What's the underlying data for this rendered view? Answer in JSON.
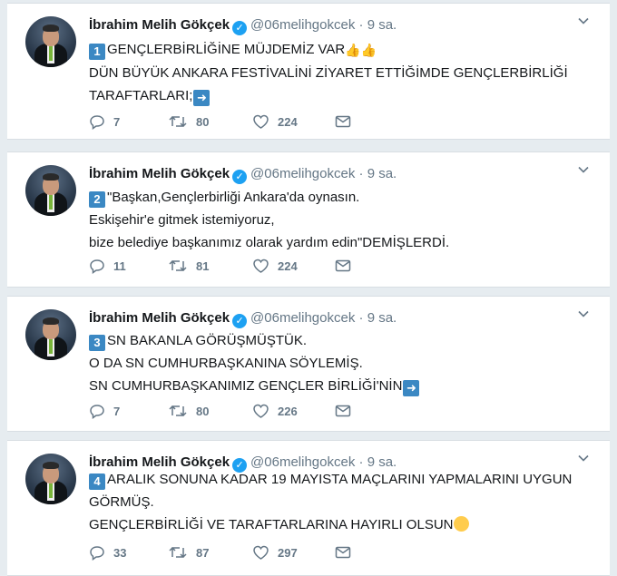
{
  "tweets": [
    {
      "author": "İbrahim Melih Gökçek",
      "handle": "@06melihgokcek",
      "separator": "·",
      "time": "9 sa.",
      "number": "1",
      "lines": [
        "GENÇLERBİRLİĞİNE MÜJDEMİZ VAR",
        "DÜN BÜYÜK ANKARA FESTİVALİNİ ZİYARET ETTİĞİMDE GENÇLERBİRLİĞİ",
        "TARAFTARLARI;"
      ],
      "replies": "7",
      "retweets": "80",
      "likes": "224"
    },
    {
      "author": "İbrahim Melih Gökçek",
      "handle": "@06melihgokcek",
      "separator": "·",
      "time": "9 sa.",
      "number": "2",
      "lines": [
        "\"Başkan,Gençlerbirliği Ankara'da oynasın.",
        "Eskişehir'e gitmek istemiyoruz,",
        "bize belediye başkanımız olarak yardım edin\"DEMİŞLERDİ."
      ],
      "replies": "11",
      "retweets": "81",
      "likes": "224"
    },
    {
      "author": "İbrahim Melih Gökçek",
      "handle": "@06melihgokcek",
      "separator": "·",
      "time": "9 sa.",
      "number": "3",
      "lines": [
        "SN BAKANLA GÖRÜŞMÜŞTÜK.",
        "O DA SN CUMHURBAŞKANINA SÖYLEMİŞ.",
        "SN CUMHURBAŞKANIMIZ GENÇLER BİRLİĞİ'NİN"
      ],
      "replies": "7",
      "retweets": "80",
      "likes": "226"
    },
    {
      "author": "İbrahim Melih Gökçek",
      "handle": "@06melihgokcek",
      "separator": "·",
      "time": "9 sa.",
      "number": "4",
      "lines": [
        "ARALIK SONUNA KADAR 19 MAYISTA MAÇLARINI YAPMALARINI UYGUN",
        "GÖRMÜŞ.",
        "GENÇLERBİRLİĞİ VE TARAFTARLARINA HAYIRLI OLSUN"
      ],
      "replies": "33",
      "retweets": "87",
      "likes": "297"
    }
  ],
  "icons": {
    "reply": "reply-icon",
    "retweet": "retweet-icon",
    "like": "heart-icon",
    "dm": "envelope-icon",
    "menu": "chevron-down-icon",
    "verified": "verified-badge-icon"
  },
  "colors": {
    "background": "#e6ecf0",
    "card": "#ffffff",
    "text": "#14171a",
    "muted": "#657786",
    "verified": "#1da1f2",
    "keycap": "#3b88c3"
  }
}
